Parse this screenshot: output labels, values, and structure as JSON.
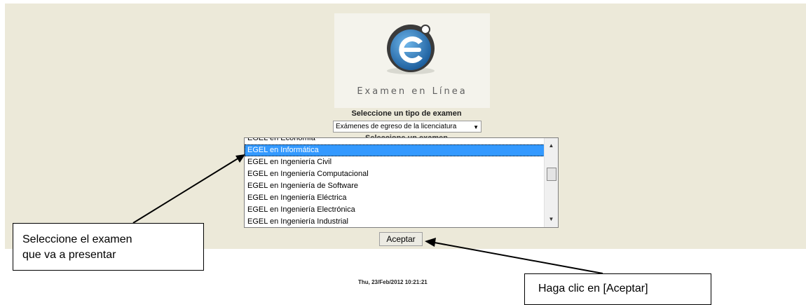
{
  "logo": {
    "text": "Examen en Línea"
  },
  "exam_type": {
    "heading": "Seleccione un tipo de examen",
    "selected": "Exámenes de egreso de la licenciatura"
  },
  "exam": {
    "heading": "Seleccione un examen",
    "items": [
      "EGEL en Economía",
      "EGEL en Informática",
      "EGEL en Ingeniería Civil",
      "EGEL en Ingeniería Computacional",
      "EGEL en Ingeniería de Software",
      "EGEL en Ingeniería Eléctrica",
      "EGEL en Ingeniería Electrónica",
      "EGEL en Ingeniería Industrial"
    ],
    "selected_item": "EGEL en Informática"
  },
  "aceptar_label": "Aceptar",
  "timestamp": "Thu, 23/Feb/2012 10:21:21",
  "callouts": {
    "left_line1": "Seleccione el examen",
    "left_line2": "que va a presentar",
    "right": "Haga clic en [Aceptar]"
  },
  "colors": {
    "panel_bg": "#ece9d9",
    "selection": "#3399ff",
    "logo_blue": "#2a7fc4"
  }
}
